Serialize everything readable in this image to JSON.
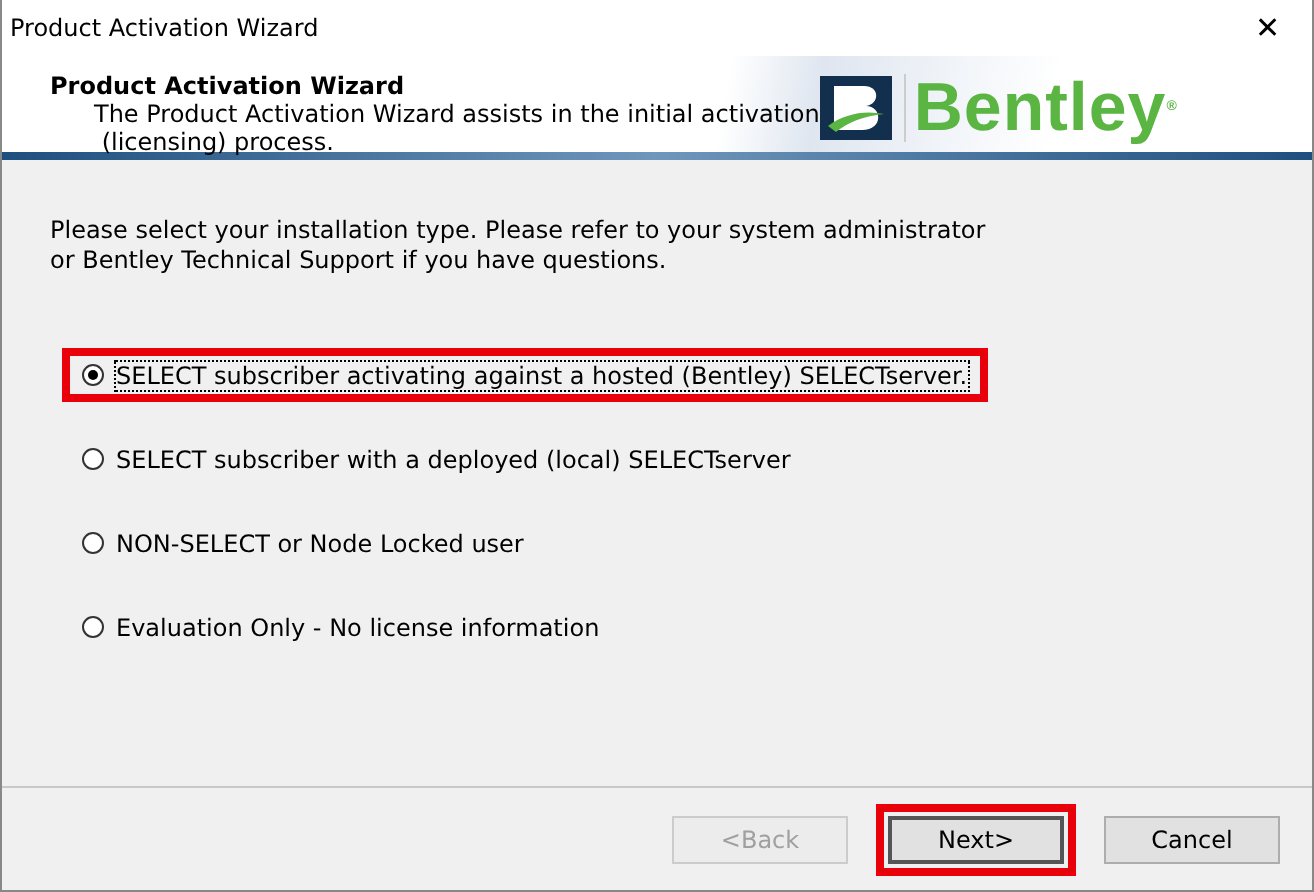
{
  "window": {
    "title": "Product Activation Wizard",
    "close": "✕"
  },
  "header": {
    "title": "Product Activation Wizard",
    "description": "The Product Activation Wizard assists in the initial activation\n (licensing) process.",
    "logo": "Bentley",
    "logo_mark": "®"
  },
  "instructions": "Please select your installation type. Please refer to your system administrator or Bentley Technical Support if you have questions.",
  "options": [
    {
      "label": "SELECT subscriber activating against a hosted (Bentley) SELECTserver.",
      "selected": true,
      "highlighted": true
    },
    {
      "label": "SELECT subscriber with a deployed (local) SELECTserver",
      "selected": false,
      "highlighted": false
    },
    {
      "label": "NON-SELECT or Node Locked user",
      "selected": false,
      "highlighted": false
    },
    {
      "label": "Evaluation Only - No license information",
      "selected": false,
      "highlighted": false
    }
  ],
  "buttons": [
    {
      "label": "<Back",
      "disabled": true,
      "highlighted": false
    },
    {
      "label": "Next>",
      "disabled": false,
      "highlighted": true
    },
    {
      "label": "Cancel",
      "disabled": false,
      "highlighted": false
    }
  ]
}
